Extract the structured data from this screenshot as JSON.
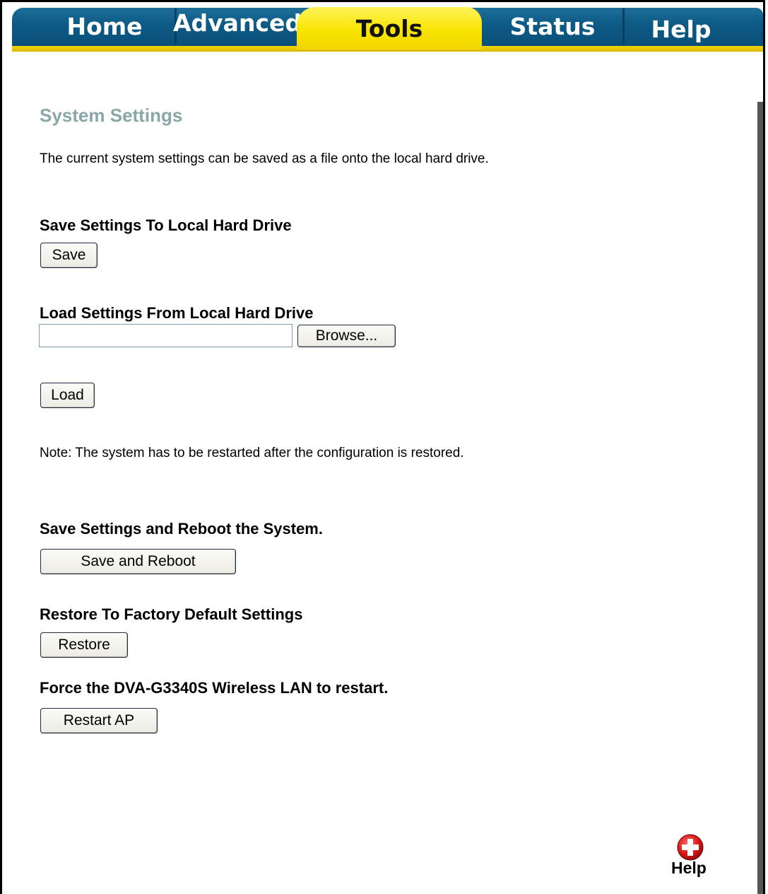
{
  "nav": {
    "tabs": [
      {
        "label": "Home",
        "active": false
      },
      {
        "label": "Advanced",
        "active": false
      },
      {
        "label": "Tools",
        "active": true
      },
      {
        "label": "Status",
        "active": false
      },
      {
        "label": "Help",
        "active": false
      }
    ]
  },
  "page": {
    "title": "System Settings",
    "intro": "The current system settings can be saved as a file onto the local hard drive.",
    "save_section": {
      "heading": "Save Settings To Local Hard Drive",
      "button": "Save"
    },
    "load_section": {
      "heading": "Load Settings From Local Hard Drive",
      "file_value": "",
      "browse_button": "Browse...",
      "load_button": "Load"
    },
    "note": "Note: The system has to be restarted after the configuration is restored.",
    "reboot_section": {
      "heading": "Save Settings and Reboot the System.",
      "button": "Save and Reboot"
    },
    "restore_section": {
      "heading": "Restore To Factory Default Settings",
      "button": "Restore"
    },
    "restart_section": {
      "heading": "Force the DVA-G3340S Wireless LAN to restart.",
      "button": "Restart AP"
    }
  },
  "help": {
    "label": "Help",
    "icon": "help-plus-icon"
  },
  "colors": {
    "tab_blue": "#0d5a86",
    "tab_active_yellow": "#f8e400",
    "title_gray": "#8aa7a8"
  }
}
